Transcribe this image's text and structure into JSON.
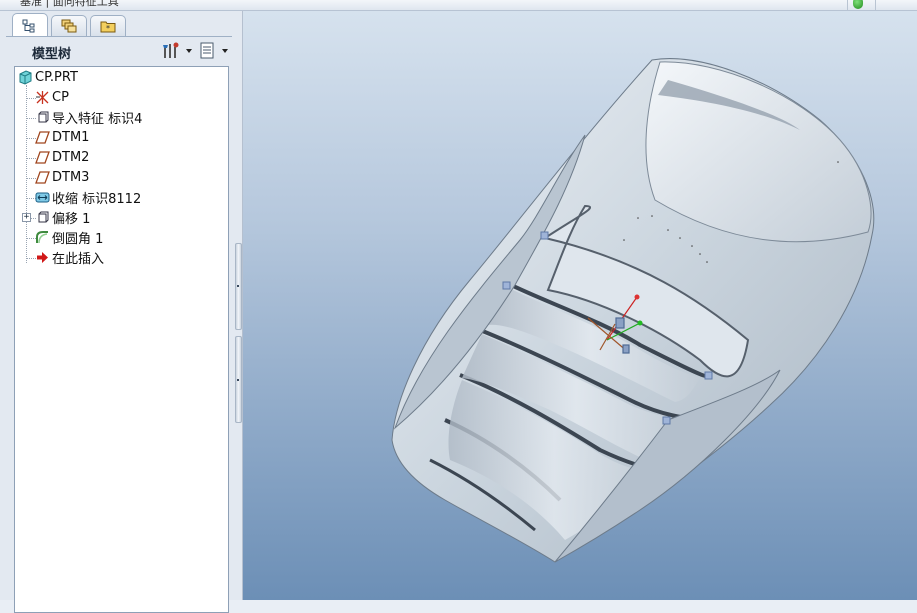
{
  "window": {
    "breadcrumb": "基准 | 面向特征工具",
    "status_icon": "green-led-icon"
  },
  "panel": {
    "tabs": [
      {
        "icon": "model-tree-icon",
        "active": true
      },
      {
        "icon": "layers-icon",
        "active": false
      },
      {
        "icon": "favorites-folder-icon",
        "active": false
      }
    ],
    "title": "模型树",
    "settings_icon": "tree-settings-icon",
    "show_icon": "tree-show-icon"
  },
  "tree": {
    "root": "CP.PRT",
    "items": [
      {
        "label": "CP",
        "icon": "csys-icon"
      },
      {
        "label": "导入特征 标识4",
        "icon": "import-feature-icon"
      },
      {
        "label": "DTM1",
        "icon": "datum-plane-icon"
      },
      {
        "label": "DTM2",
        "icon": "datum-plane-icon"
      },
      {
        "label": "DTM3",
        "icon": "datum-plane-icon"
      },
      {
        "label": "收缩 标识8112",
        "icon": "shrink-icon"
      },
      {
        "label": "偏移 1",
        "icon": "offset-icon",
        "expandable": true
      },
      {
        "label": "倒圆角 1",
        "icon": "round-icon"
      },
      {
        "label": "在此插入",
        "icon": "insert-here-arrow-icon"
      }
    ]
  },
  "colors": {
    "viewport_top": "#d6e2ee",
    "viewport_bottom": "#6c8fb6",
    "part_surface": "#c9d3dc",
    "insert_arrow": "#d01818"
  }
}
